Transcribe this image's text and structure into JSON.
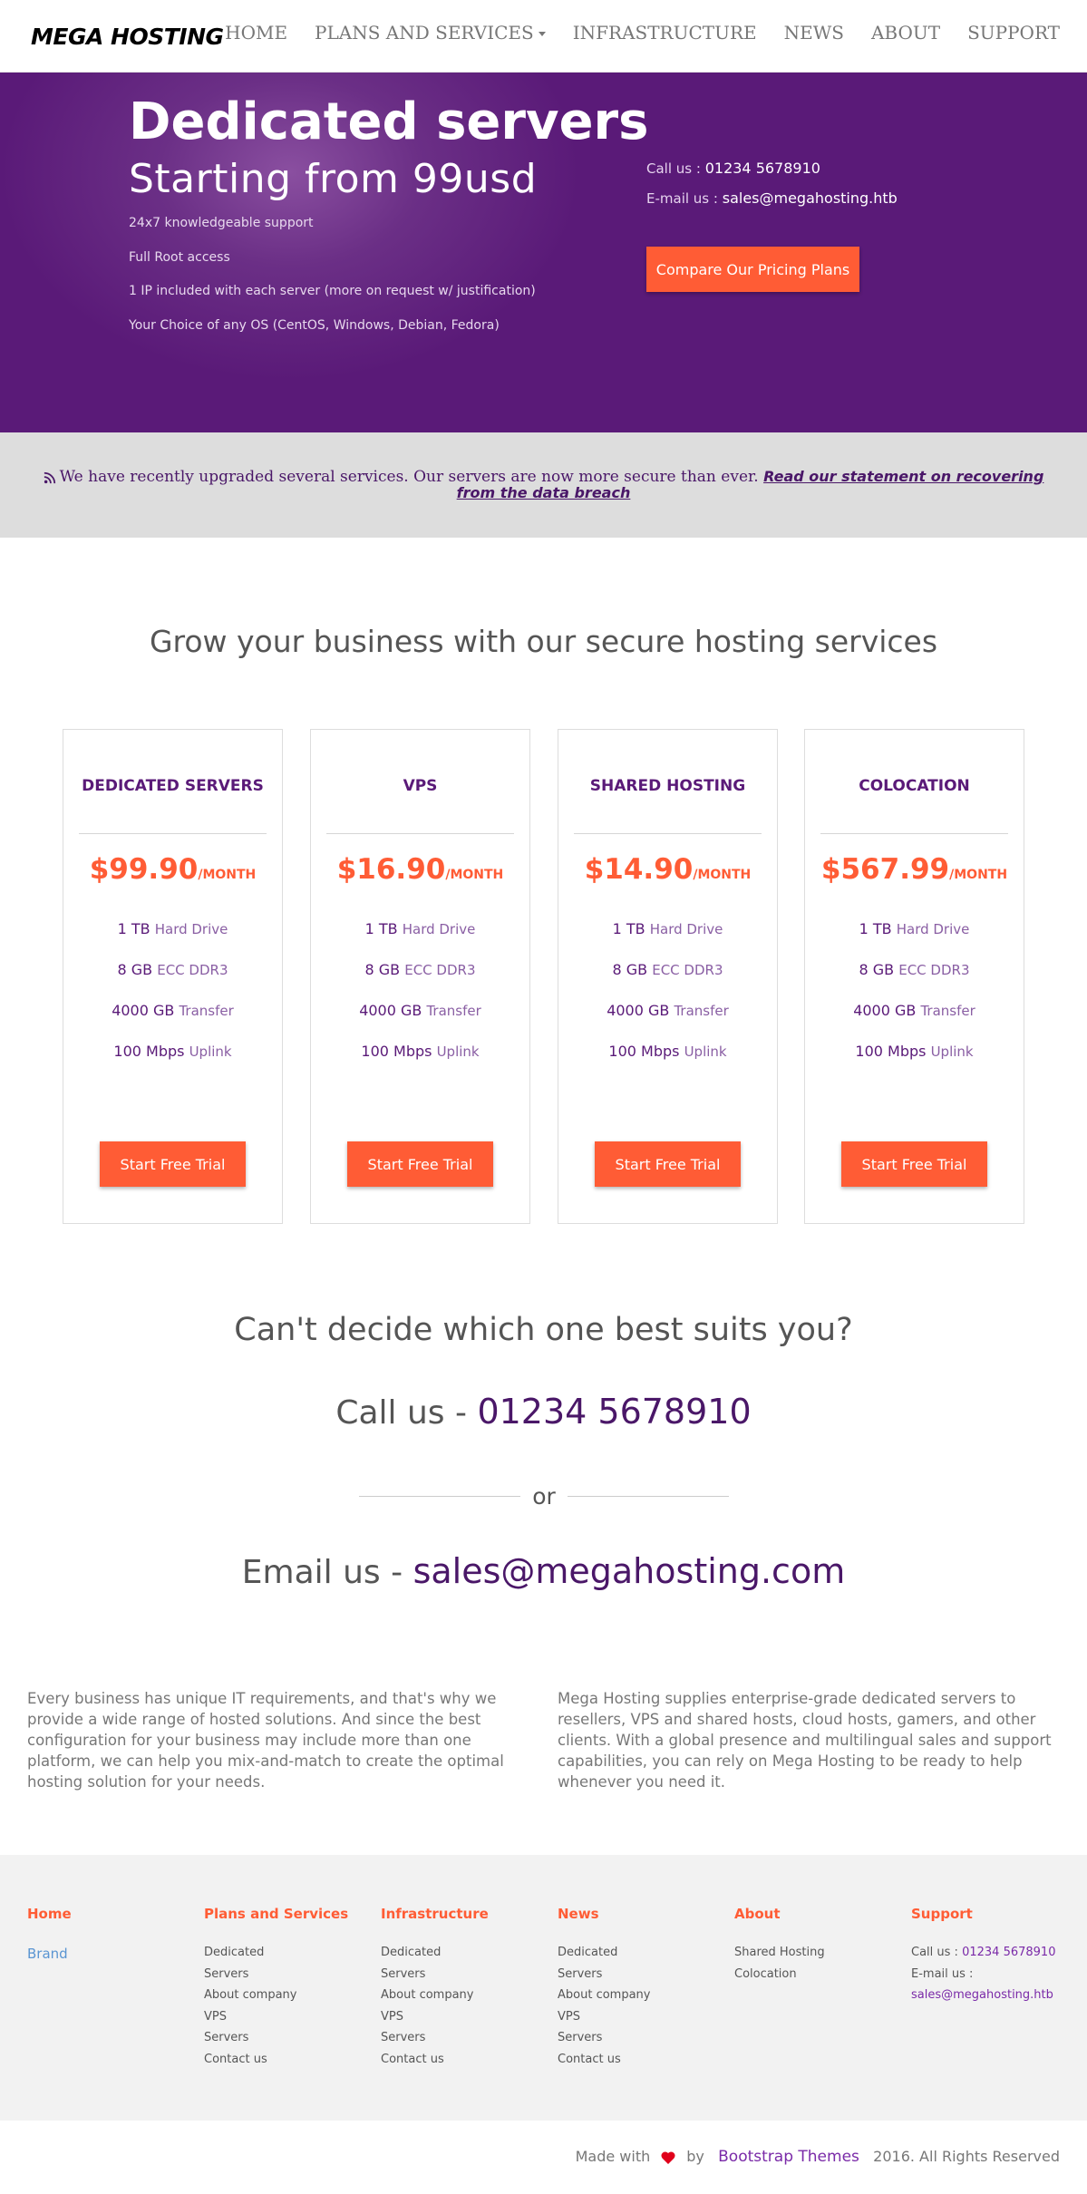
{
  "navbar": {
    "brand": "MEGA HOSTING",
    "items": [
      {
        "label": "HOME"
      },
      {
        "label": "PLANS AND SERVICES"
      },
      {
        "label": "INFRASTRUCTURE"
      },
      {
        "label": "NEWS"
      },
      {
        "label": "ABOUT"
      },
      {
        "label": "SUPPORT"
      }
    ]
  },
  "hero": {
    "title": "Dedicated servers",
    "subtitle": "Starting from 99usd",
    "features": [
      "24x7 knowledgeable support",
      "Full Root access",
      "1 IP included with each server (more on request w/ justification)",
      "Your Choice of any OS (CentOS, Windows, Debian, Fedora)"
    ],
    "call_label": "Call us :",
    "call_value": "01234 5678910",
    "email_label": "E-mail us :",
    "email_value": "sales@megahosting.htb",
    "button": "Compare Our Pricing Plans"
  },
  "announcement": {
    "text": "We have recently upgraded several services. Our servers are now more secure than ever.",
    "link": "Read our statement on recovering from the data breach"
  },
  "section_title": "Grow your business with our secure hosting services",
  "plans": [
    {
      "name": "DEDICATED SERVERS",
      "price": "$99.90",
      "per": "/MONTH",
      "features": [
        {
          "qty": "1 TB",
          "unit": "Hard Drive"
        },
        {
          "qty": "8 GB",
          "unit": "ECC DDR3"
        },
        {
          "qty": "4000 GB",
          "unit": "Transfer"
        },
        {
          "qty": "100 Mbps",
          "unit": "Uplink"
        }
      ],
      "button": "Start Free Trial"
    },
    {
      "name": "VPS",
      "price": "$16.90",
      "per": "/MONTH",
      "features": [
        {
          "qty": "1 TB",
          "unit": "Hard Drive"
        },
        {
          "qty": "8 GB",
          "unit": "ECC DDR3"
        },
        {
          "qty": "4000 GB",
          "unit": "Transfer"
        },
        {
          "qty": "100 Mbps",
          "unit": "Uplink"
        }
      ],
      "button": "Start Free Trial"
    },
    {
      "name": "SHARED HOSTING",
      "price": "$14.90",
      "per": "/MONTH",
      "features": [
        {
          "qty": "1 TB",
          "unit": "Hard Drive"
        },
        {
          "qty": "8 GB",
          "unit": "ECC DDR3"
        },
        {
          "qty": "4000 GB",
          "unit": "Transfer"
        },
        {
          "qty": "100 Mbps",
          "unit": "Uplink"
        }
      ],
      "button": "Start Free Trial"
    },
    {
      "name": "COLOCATION",
      "price": "$567.99",
      "per": "/MONTH",
      "features": [
        {
          "qty": "1 TB",
          "unit": "Hard Drive"
        },
        {
          "qty": "8 GB",
          "unit": "ECC DDR3"
        },
        {
          "qty": "4000 GB",
          "unit": "Transfer"
        },
        {
          "qty": "100 Mbps",
          "unit": "Uplink"
        }
      ],
      "button": "Start Free Trial"
    }
  ],
  "cta": {
    "question": "Can't decide which one best suits you?",
    "call_prefix": "Call us - ",
    "call_number": "01234 5678910",
    "or": "or",
    "email_prefix": "Email us - ",
    "email_address": "sales@megahosting.com"
  },
  "about": {
    "left": "Every business has unique IT requirements, and that's why we provide a wide range of hosted solutions. And since the best configuration for your business may include more than one platform, we can help you mix-and-match to create the optimal hosting solution for your needs.",
    "right": "Mega Hosting supplies enterprise-grade dedicated servers to resellers, VPS and shared hosts, cloud hosts, gamers, and other clients. With a global presence and multilingual sales and support capabilities, you can rely on Mega Hosting to be ready to help whenever you need it."
  },
  "footer": {
    "home": {
      "title": "Home",
      "brand": "Brand"
    },
    "plans": {
      "title": "Plans and Services",
      "items": [
        "Dedicated",
        "Servers",
        "About company",
        "VPS",
        "Servers",
        "Contact us"
      ]
    },
    "infra": {
      "title": "Infrastructure",
      "items": [
        "Dedicated",
        "Servers",
        "About company",
        "VPS",
        "Servers",
        "Contact us"
      ]
    },
    "news": {
      "title": "News",
      "items": [
        "Dedicated",
        "Servers",
        "About company",
        "VPS",
        "Servers",
        "Contact us"
      ]
    },
    "about": {
      "title": "About",
      "items": [
        "Shared Hosting",
        "Colocation"
      ]
    },
    "support": {
      "title": "Support",
      "call_label": "Call us :",
      "call_value": "01234 5678910",
      "email_label": "E-mail us :",
      "email_value": "sales@megahosting.htb"
    }
  },
  "bottom": {
    "made_with": "Made with",
    "by": "by",
    "link": "Bootstrap Themes",
    "rights": "2016. All Rights Reserved"
  },
  "colors": {
    "purple": "#5a1a78",
    "orange": "#ff5c35",
    "heart": "#e0001b"
  },
  "icons": [
    "rss-icon",
    "heart-icon",
    "caret-down-icon"
  ]
}
